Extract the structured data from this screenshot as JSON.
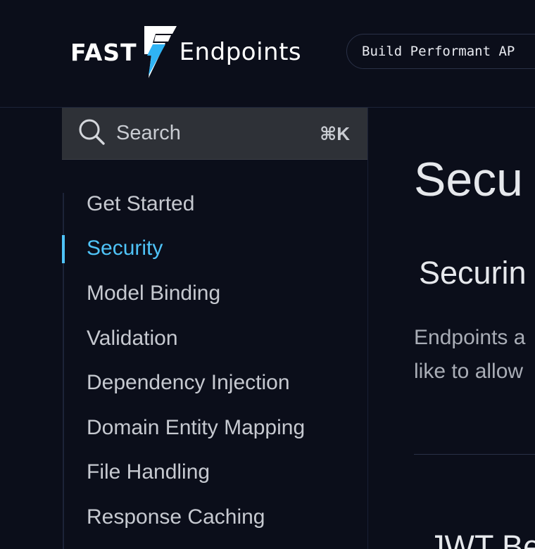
{
  "header": {
    "logo": {
      "word_left": "FAST",
      "word_right": "Endpoints",
      "bolt_color": "#2fb4f5"
    },
    "tagline": "Build Performant AP"
  },
  "search": {
    "placeholder": "Search",
    "shortcut": "⌘K"
  },
  "sidebar": {
    "items": [
      {
        "label": "Get Started",
        "active": false
      },
      {
        "label": "Security",
        "active": true
      },
      {
        "label": "Model Binding",
        "active": false
      },
      {
        "label": "Validation",
        "active": false
      },
      {
        "label": "Dependency Injection",
        "active": false
      },
      {
        "label": "Domain Entity Mapping",
        "active": false
      },
      {
        "label": "File Handling",
        "active": false
      },
      {
        "label": "Response Caching",
        "active": false
      }
    ]
  },
  "main": {
    "title": "Secu",
    "section_heading": "Securin",
    "body_line_1": "Endpoints a",
    "body_line_2": "like to allow",
    "subheading": "JWT Be"
  },
  "colors": {
    "background": "#0b0e1a",
    "accent": "#4fc3f7",
    "search_bg": "#2e3137"
  }
}
